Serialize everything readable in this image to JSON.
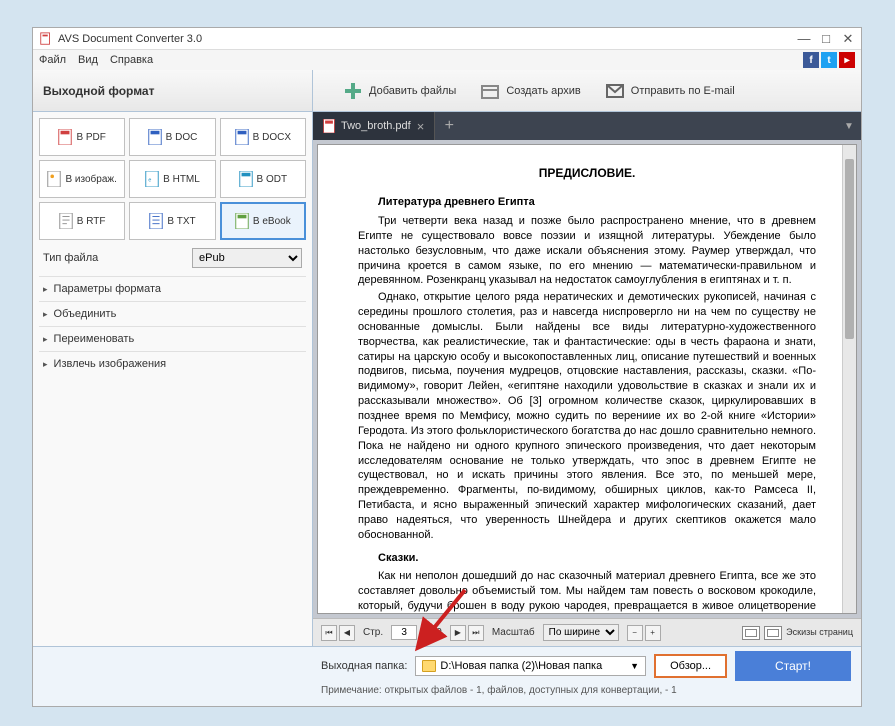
{
  "window": {
    "title": "AVS Document Converter 3.0"
  },
  "menubar": {
    "file": "Файл",
    "view": "Вид",
    "help": "Справка"
  },
  "toolbar": {
    "sidebar_header": "Выходной формат",
    "add_files": "Добавить файлы",
    "create_archive": "Создать архив",
    "send_email": "Отправить по E-mail"
  },
  "formats": {
    "pdf": "В PDF",
    "doc": "В DOC",
    "docx": "В DOCX",
    "image": "В изображ.",
    "html": "В HTML",
    "odt": "В ODT",
    "rtf": "В RTF",
    "txt": "В TXT",
    "ebook": "В eBook"
  },
  "file_type": {
    "label": "Тип файла",
    "value": "ePub"
  },
  "expanders": {
    "format_params": "Параметры формата",
    "merge": "Объединить",
    "rename": "Переименовать",
    "extract_images": "Извлечь изображения"
  },
  "tab": {
    "name": "Two_broth.pdf"
  },
  "document": {
    "title": "ПРЕДИСЛОВИЕ.",
    "h1": "Литература древнего Египта",
    "p1": "Три четверти века назад и позже было распространено мнение, что в древнем Египте не существовало вовсе поэзии и изящной литературы. Убеждение было настолько безусловным, что даже искали объяснения этому. Раумер утверждал, что причина кроется в самом языке, по его мнению — математически-правильном и деревянном. Розенкранц указывал на недостаток самоуглубления в египтянах и т. п.",
    "p2": "Однако, открытие целого ряда нератических и демотических рукописей, начиная с середины прошлого столетия, раз и навсегда ниспровергло ни на чем по существу не основанные домыслы. Были найдены все виды литературно-художественного творчества, как реалистические, так и фантастические: оды в честь фараона и знати, сатиры на царскую особу и высокопоставленных лиц, описание путешествий и военных подвигов, письма, поучения мудрецов, отцовские наставления, рассказы, сказки. «По-видимому», говорит Лейен, «египтяне находили удовольствие в сказках и знали их и рассказывали множество». Об [3] огромном количестве сказок, циркулировавших в позднее время по Мемфису, можно судить по верениие их во 2-ой книге «Истории» Геродота. Из этого фольклористического богатства до нас дошло сравнительно немного. Пока не найдено ни одного крупного эпического произведения, что дает некоторым исследователям основание не только утверждать, что эпос в древнем Египте не существовал, но и искать причины этого явления. Все это, по меньшей мере, преждевременно. Фрагменты, по-видимому, обширных циклов, как-то Рамсеса II, Петибаста, и ясно выраженный эпический характер мифологических сказаний, дает право надеяться, что уверенность Шнейдера и других скептиков окажется мало обоснованной.",
    "h2": "Сказки.",
    "p3": "Как ни неполон дошедший до нас сказочный материал древнего Египта, все же это составляет довольно объемистый том. Мы найдем там повесть о восковом крокодиле, который, будучи брошен в воду рукою чародея, превращается в живое олицетворение бога Собка, карающего смертью прелюбодея, а потом снова принимающего вид небольшой восковой фигурки. Рассказы с захватывающим интересом похождения мудреца в царстве мумий, побуждающих его спуститься на дно Коптского моря в поисках волшебной книги Тота, сияющей как солнце и сообщающей сверхчеловеческое ведение. Одно за другим совершаются превращения несчастных детей, тщательно волнующих с подложивскоим"
  },
  "doc_controls": {
    "page_label": "Стр.",
    "page_current": "3",
    "page_total": "/ 50",
    "zoom_label": "Масштаб",
    "zoom_value": "По ширине",
    "thumbnails": "Эскизы страниц"
  },
  "output": {
    "label": "Выходная папка:",
    "path": "D:\\Новая папка (2)\\Новая папка",
    "browse": "Обзор...",
    "start": "Старт!",
    "note": "Примечание: открытых файлов - 1, файлов, доступных для конвертации, - 1"
  }
}
